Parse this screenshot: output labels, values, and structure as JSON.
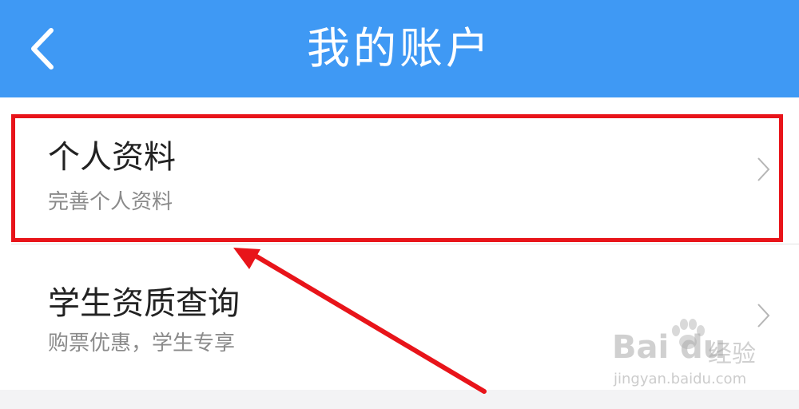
{
  "header": {
    "title": "我的账户",
    "back_icon": "chevron-left-icon",
    "background_color": "#3f99f4"
  },
  "list": {
    "items": [
      {
        "title": "个人资料",
        "subtitle": "完善个人资料",
        "icon": "chevron-right-icon"
      },
      {
        "title": "学生资质查询",
        "subtitle": "购票优惠，学生专享",
        "icon": "chevron-right-icon"
      }
    ]
  },
  "annotation": {
    "box_color": "#e8141a",
    "arrow_color": "#e8141a"
  },
  "watermark": {
    "brand": "Bai du",
    "brand_cn": "经验",
    "url": "jingyan.baidu.com"
  }
}
